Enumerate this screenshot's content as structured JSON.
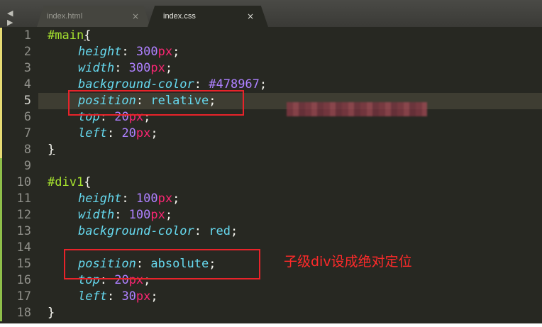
{
  "tabs": [
    {
      "label": "index.html",
      "close": "×"
    },
    {
      "label": "index.css",
      "close": "×"
    }
  ],
  "nav": {
    "arrows": "◀ ▶"
  },
  "lines": [
    {
      "n": "1",
      "tokens": [
        {
          "t": "#main",
          "c": "sel"
        },
        {
          "t": "{",
          "c": "punc brace-u"
        }
      ]
    },
    {
      "n": "2",
      "indent": true,
      "tokens": [
        {
          "t": "height",
          "c": "prop"
        },
        {
          "t": ": ",
          "c": "punc"
        },
        {
          "t": "300",
          "c": "num"
        },
        {
          "t": "px",
          "c": "unit"
        },
        {
          "t": ";",
          "c": "punc"
        }
      ]
    },
    {
      "n": "3",
      "indent": true,
      "tokens": [
        {
          "t": "width",
          "c": "prop"
        },
        {
          "t": ": ",
          "c": "punc"
        },
        {
          "t": "300",
          "c": "num"
        },
        {
          "t": "px",
          "c": "unit"
        },
        {
          "t": ";",
          "c": "punc"
        }
      ]
    },
    {
      "n": "4",
      "indent": true,
      "tokens": [
        {
          "t": "background-color",
          "c": "prop"
        },
        {
          "t": ": ",
          "c": "punc"
        },
        {
          "t": "#478967",
          "c": "num"
        },
        {
          "t": ";",
          "c": "punc"
        }
      ]
    },
    {
      "n": "5",
      "indent": true,
      "tokens": [
        {
          "t": "position",
          "c": "prop"
        },
        {
          "t": ": ",
          "c": "punc"
        },
        {
          "t": "relative",
          "c": "val"
        },
        {
          "t": ";",
          "c": "punc"
        }
      ]
    },
    {
      "n": "6",
      "indent": true,
      "tokens": [
        {
          "t": "top",
          "c": "prop"
        },
        {
          "t": ": ",
          "c": "punc"
        },
        {
          "t": "20",
          "c": "num"
        },
        {
          "t": "px",
          "c": "unit"
        },
        {
          "t": ";",
          "c": "punc"
        }
      ]
    },
    {
      "n": "7",
      "indent": true,
      "tokens": [
        {
          "t": "left",
          "c": "prop"
        },
        {
          "t": ": ",
          "c": "punc"
        },
        {
          "t": "20",
          "c": "num"
        },
        {
          "t": "px",
          "c": "unit"
        },
        {
          "t": ";",
          "c": "punc"
        }
      ]
    },
    {
      "n": "8",
      "tokens": [
        {
          "t": "}",
          "c": "punc brace-u"
        }
      ]
    },
    {
      "n": "9",
      "tokens": []
    },
    {
      "n": "10",
      "tokens": [
        {
          "t": "#div1",
          "c": "sel"
        },
        {
          "t": "{",
          "c": "punc"
        }
      ]
    },
    {
      "n": "11",
      "indent": true,
      "tokens": [
        {
          "t": "height",
          "c": "prop"
        },
        {
          "t": ": ",
          "c": "punc"
        },
        {
          "t": "100",
          "c": "num"
        },
        {
          "t": "px",
          "c": "unit"
        },
        {
          "t": ";",
          "c": "punc"
        }
      ]
    },
    {
      "n": "12",
      "indent": true,
      "tokens": [
        {
          "t": "width",
          "c": "prop"
        },
        {
          "t": ": ",
          "c": "punc"
        },
        {
          "t": "100",
          "c": "num"
        },
        {
          "t": "px",
          "c": "unit"
        },
        {
          "t": ";",
          "c": "punc"
        }
      ]
    },
    {
      "n": "13",
      "indent": true,
      "tokens": [
        {
          "t": "background-color",
          "c": "prop"
        },
        {
          "t": ": ",
          "c": "punc"
        },
        {
          "t": "red",
          "c": "val"
        },
        {
          "t": ";",
          "c": "punc"
        }
      ]
    },
    {
      "n": "14",
      "tokens": []
    },
    {
      "n": "15",
      "indent": true,
      "tokens": [
        {
          "t": "position",
          "c": "prop"
        },
        {
          "t": ": ",
          "c": "punc"
        },
        {
          "t": "absolute",
          "c": "val"
        },
        {
          "t": ";",
          "c": "punc"
        }
      ]
    },
    {
      "n": "16",
      "indent": true,
      "tokens": [
        {
          "t": "top",
          "c": "prop"
        },
        {
          "t": ": ",
          "c": "punc"
        },
        {
          "t": "20",
          "c": "num"
        },
        {
          "t": "px",
          "c": "unit"
        },
        {
          "t": ";",
          "c": "punc"
        }
      ]
    },
    {
      "n": "17",
      "indent": true,
      "tokens": [
        {
          "t": "left",
          "c": "prop"
        },
        {
          "t": ": ",
          "c": "punc"
        },
        {
          "t": "30",
          "c": "num"
        },
        {
          "t": "px",
          "c": "unit"
        },
        {
          "t": ";",
          "c": "punc"
        }
      ]
    },
    {
      "n": "18",
      "tokens": [
        {
          "t": "}",
          "c": "punc"
        }
      ]
    }
  ],
  "current_line": "5",
  "annotation": {
    "text": "子级div设成绝对定位"
  },
  "colors": {
    "background": "#272822",
    "selector": "#a6e22e",
    "property": "#66d9ef",
    "number": "#ae81ff",
    "unit": "#f92672",
    "annotation": "#ff2a2a"
  }
}
